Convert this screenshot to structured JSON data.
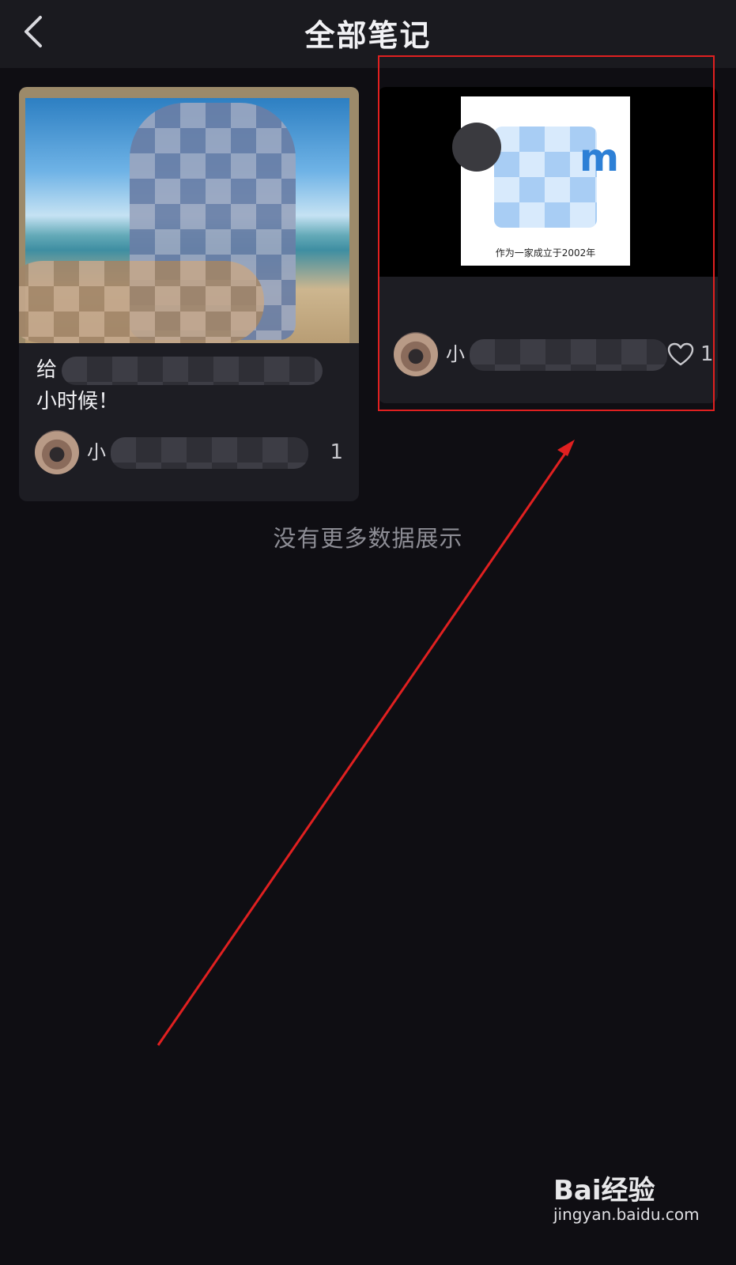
{
  "header": {
    "title": "全部笔记",
    "back_icon": "chevron-left-icon"
  },
  "notes": [
    {
      "desc_line1": "给",
      "desc_line2": "小时候！",
      "author_initial": "小",
      "likes": "1"
    },
    {
      "thumb_caption": "作为一家成立于2002年",
      "thumb_letter": "m",
      "author_initial": "小",
      "likes": "1",
      "like_icon": "heart-outline-icon"
    }
  ],
  "footer_text": "没有更多数据展示",
  "watermark": {
    "logo": "Bai经验",
    "url": "jingyan.baidu.com"
  },
  "colors": {
    "background": "#0f0e13",
    "card": "#1d1d23",
    "annotation": "#e02020"
  }
}
